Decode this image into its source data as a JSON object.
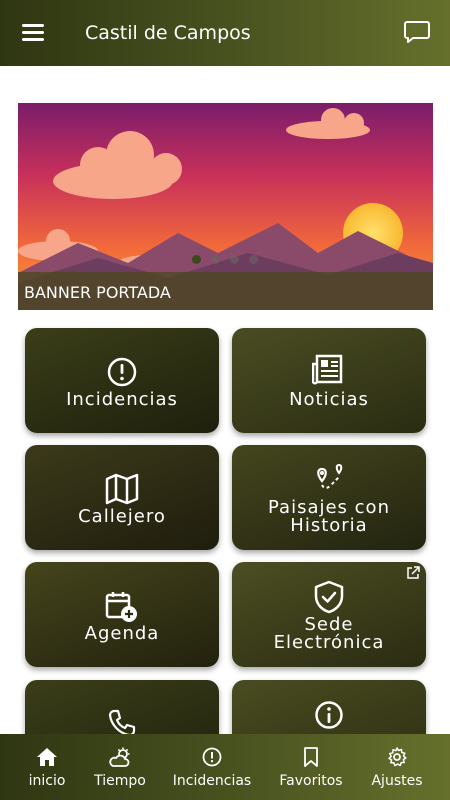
{
  "header": {
    "title": "Castil de Campos"
  },
  "banner": {
    "caption": "BANNER PORTADA",
    "slides": 4,
    "active_slide": 1
  },
  "tiles": [
    {
      "label": "Incidencias",
      "icon": "alert-circle-icon"
    },
    {
      "label": "Noticias",
      "icon": "newspaper-icon"
    },
    {
      "label": "Callejero",
      "icon": "map-icon"
    },
    {
      "label_line1": "Paisajes con",
      "label_line2": "Historia",
      "icon": "route-pin-icon"
    },
    {
      "label": "Agenda",
      "icon": "calendar-add-icon"
    },
    {
      "label_line1": "Sede",
      "label_line2": "Electrónica",
      "icon": "shield-check-icon",
      "external": true
    },
    {
      "label": "",
      "icon": "phone-icon"
    },
    {
      "label": "",
      "icon": "info-icon"
    }
  ],
  "bottom_nav": [
    {
      "label": "inicio",
      "icon": "home-icon"
    },
    {
      "label": "Tiempo",
      "icon": "weather-icon"
    },
    {
      "label": "Incidencias",
      "icon": "alert-circle-icon"
    },
    {
      "label": "Favoritos",
      "icon": "bookmark-icon"
    },
    {
      "label": "Ajustes",
      "icon": "gear-icon"
    }
  ],
  "colors": {
    "primary_dark": "#2f3612",
    "primary_light": "#66702c",
    "tile_bg": "#2a2c12"
  }
}
